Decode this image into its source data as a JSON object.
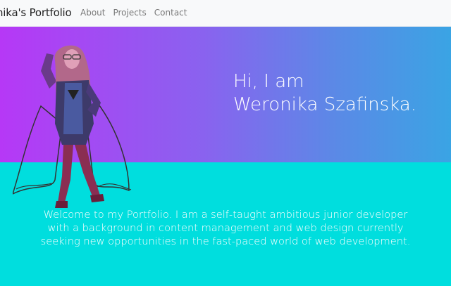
{
  "navbar": {
    "brand": "onika's Portfolio",
    "links": [
      "About",
      "Projects",
      "Contact"
    ]
  },
  "hero": {
    "greeting_line1": "Hi, I am",
    "greeting_line2": "Weronika Szafinska."
  },
  "intro": {
    "line1": "Welcome to my Portfolio. I am a self-taught ambitious junior developer",
    "line2": "with a background in content management and web design currently",
    "line3": "seeking new opportunities in the fast-paced world of web development."
  },
  "colors": {
    "gradient_start": "#b638f6",
    "gradient_end": "#3aa4e4",
    "band": "#00dede",
    "text": "#ffffff"
  },
  "icons": [
    "portrait-figure"
  ]
}
